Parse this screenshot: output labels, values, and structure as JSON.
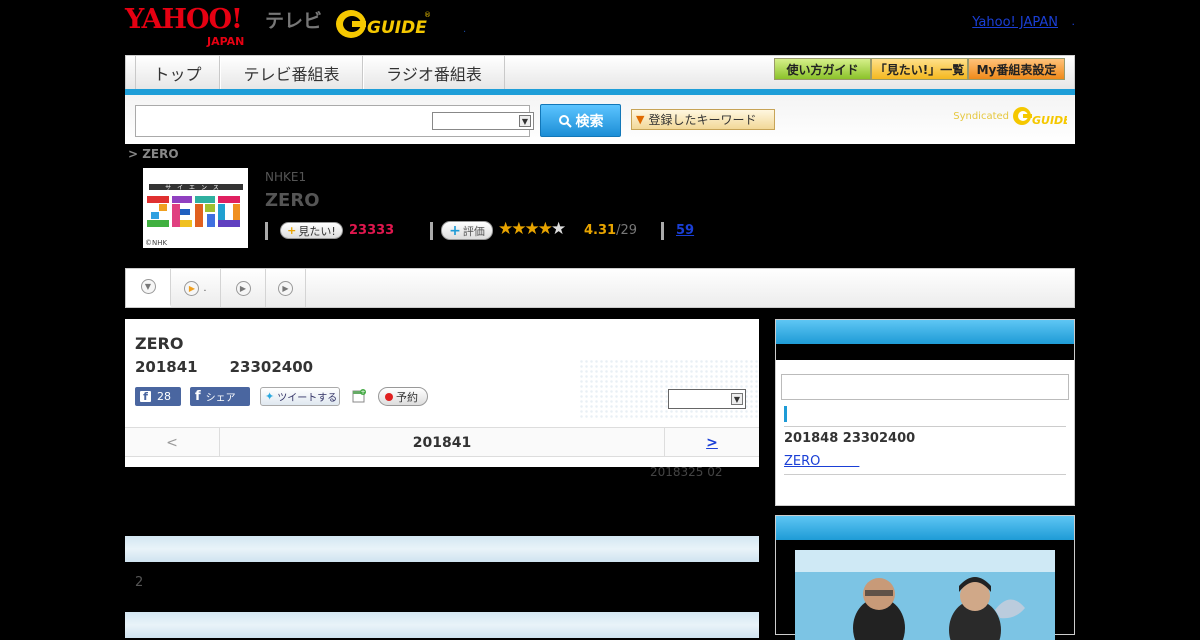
{
  "header": {
    "yahoo_logo": "YAHOO!",
    "yahoo_logo_sub": "JAPAN",
    "tv_label": "テレビ",
    "gguide_logo": "G-GUIDE",
    "dot_link": ".",
    "yahoo_japan_link": "Yahoo! JAPAN",
    "trailing_dot": "."
  },
  "nav": {
    "tabs": [
      {
        "label": "トップ"
      },
      {
        "label": "テレビ番組表"
      },
      {
        "label": "ラジオ番組表"
      }
    ],
    "guide_button": "使い方ガイド",
    "mitai_list_button": "「見たい!」一覧",
    "my_schedule_button": "My番組表設定"
  },
  "search": {
    "input_value": "",
    "select_value": "",
    "button_label": "検索",
    "keyword_button": "登録したキーワード",
    "syndicated": "Syndicated"
  },
  "breadcrumb": "> ZERO",
  "program": {
    "thumb_caption": "©NHK",
    "thumb_logo": "ZERO",
    "thumb_sub": "サイエンス",
    "channel": "NHKE1",
    "title": "ZERO",
    "mitai_label": "見たい!",
    "mitai_count": "23333",
    "hyoka_label": "評価",
    "stars": 4.31,
    "rating": "4.31",
    "rating_count": "/29",
    "review_link": "59"
  },
  "play_tabs": [
    {
      "icon": "chevron-down",
      "label": ""
    },
    {
      "icon": "play",
      "label": "."
    },
    {
      "icon": "play",
      "label": ""
    },
    {
      "icon": "play",
      "label": ""
    }
  ],
  "episode": {
    "title": "ZERO",
    "date": "201841",
    "time": "23302400",
    "fb_like_count": "28",
    "fb_share_label": "シェア",
    "tweet_label": "ツイートする",
    "yoyaku_label": "予約",
    "select_value": "",
    "pager_prev": "<",
    "pager_label": "201841",
    "pager_next": ">",
    "update_note": "2018325  02"
  },
  "section1_text": "2",
  "right_column": {
    "search_value": "",
    "next_date": "201848  23302400",
    "next_link": "ZERO　　　"
  },
  "colors": {
    "accent_blue": "#1e9ed8",
    "mitai_red": "#e0174e",
    "star_gold": "#e8a400",
    "link_blue": "#1a3fd6"
  }
}
